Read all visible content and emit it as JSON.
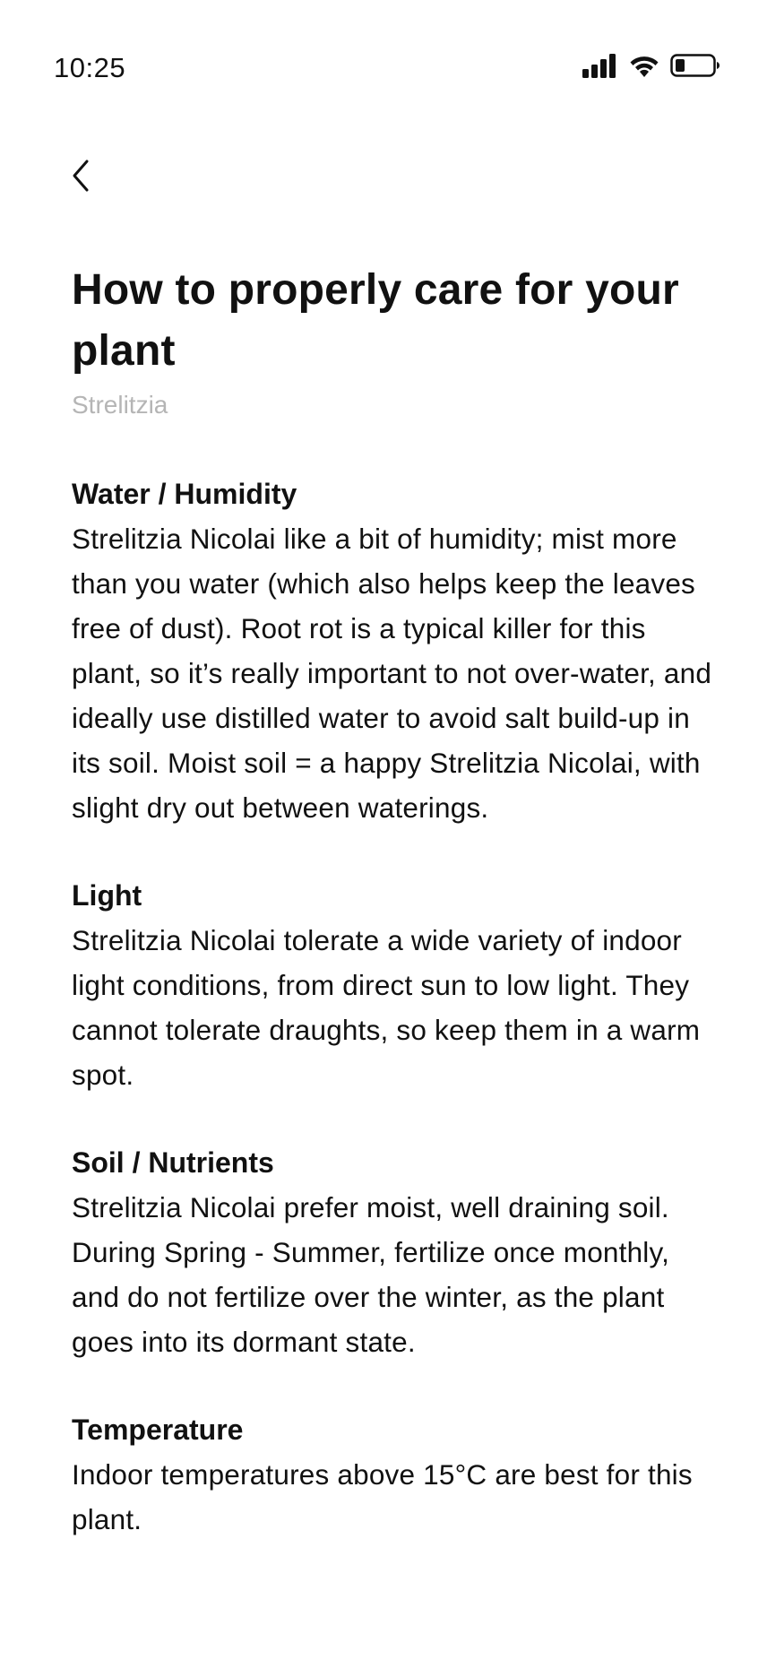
{
  "status_bar": {
    "time": "10:25",
    "icons": [
      "signal-icon",
      "wifi-icon",
      "battery-icon"
    ]
  },
  "nav": {
    "back_icon": "chevron-left-icon"
  },
  "article": {
    "title": "How to properly care for your plant",
    "subtitle": "Strelitzia",
    "sections": [
      {
        "heading": "Water / Humidity",
        "body": "Strelitzia Nicolai like a bit of humidity; mist more than you water (which also helps keep the leaves free of dust). Root rot is a typical killer for this plant, so it’s really important to not over-water, and ideally use distilled water to avoid salt build-up in its soil. Moist soil = a happy Strelitzia Nicolai, with slight dry out between waterings."
      },
      {
        "heading": "Light",
        "body": "Strelitzia Nicolai tolerate a wide variety of indoor light conditions, from direct sun to low light. They cannot tolerate draughts, so keep them in a warm spot."
      },
      {
        "heading": "Soil / Nutrients",
        "body": "Strelitzia Nicolai prefer moist, well draining soil. During Spring - Summer, fertilize once monthly, and do not fertilize over the winter, as the plant goes into its dormant state."
      },
      {
        "heading": "Temperature",
        "body": "Indoor temperatures above 15°C are best for this plant."
      }
    ]
  },
  "colors": {
    "text": "#111111",
    "subtitle": "#b5b5b5",
    "background": "#ffffff"
  }
}
